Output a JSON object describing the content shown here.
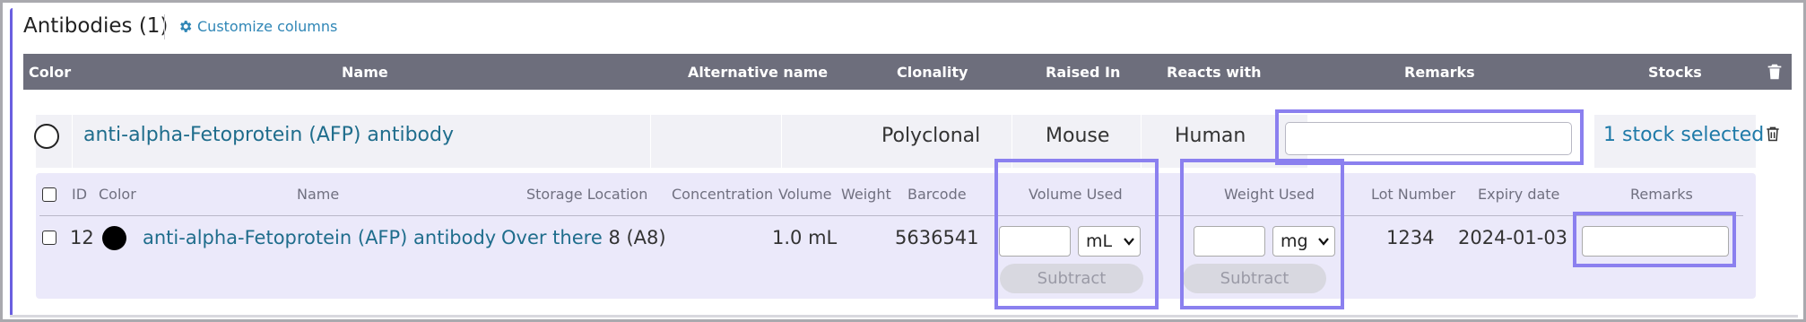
{
  "section": {
    "title": "Antibodies (1)",
    "customize_label": "Customize columns"
  },
  "table": {
    "columns": [
      "Color",
      "Name",
      "Alternative name",
      "Clonality",
      "Raised In",
      "Reacts with",
      "Remarks",
      "Stocks"
    ]
  },
  "antibody": {
    "name": "anti-alpha-Fetoprotein (AFP) antibody",
    "alternative_name": "",
    "clonality": "Polyclonal",
    "raised_in": "Mouse",
    "reacts_with": "Human",
    "remarks_value": "",
    "stocks_label": "1 stock selected"
  },
  "stocks": {
    "columns": [
      "ID",
      "Color",
      "Name",
      "Storage Location",
      "Concentration",
      "Volume",
      "Weight",
      "Barcode",
      "Volume Used",
      "Weight Used",
      "Lot Number",
      "Expiry date",
      "Remarks"
    ],
    "row": {
      "id": "12",
      "color": "#000000",
      "name": "anti-alpha-Fetoprotein (AFP) antibody",
      "storage_link": "Over there",
      "storage_rest": "8 (A8)",
      "concentration": "",
      "volume": "1.0 mL",
      "weight": "",
      "barcode": "5636541",
      "volume_used_value": "",
      "volume_unit": "mL",
      "weight_used_value": "",
      "weight_unit": "mg",
      "subtract_label": "Subtract",
      "lot_number": "1234",
      "expiry_date": "2024-01-03",
      "remarks_value": ""
    }
  },
  "colors": {
    "header_bg": "#6d6e7c",
    "link": "#1f6d8c",
    "highlight": "#8b80ef",
    "subpanel_bg": "#ebe9fa"
  }
}
